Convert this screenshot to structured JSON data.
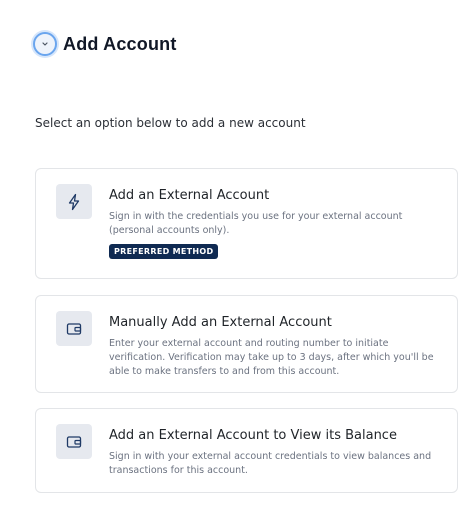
{
  "header": {
    "title": "Add Account",
    "back_icon": "chevron-down-icon"
  },
  "intro": "Select an option below to add a new account",
  "options": [
    {
      "icon": "lightning-icon",
      "title": "Add an External Account",
      "description": "Sign in with the credentials you use for your external account (personal accounts only).",
      "badge": "PREFERRED METHOD"
    },
    {
      "icon": "wallet-icon",
      "title": "Manually Add an External Account",
      "description": "Enter your external account and routing number to initiate verification. Verification may take up to 3 days, after which you'll be able to make transfers to and from this account."
    },
    {
      "icon": "wallet-icon",
      "title": "Add an External Account to View its Balance",
      "description": "Sign in with your external account credentials to view balances and transactions for this account."
    }
  ],
  "colors": {
    "accent": "#6aa5ee",
    "badge_bg": "#0f2a52",
    "icon_bg": "#e6e9ef",
    "card_border": "#e3e5e8"
  }
}
